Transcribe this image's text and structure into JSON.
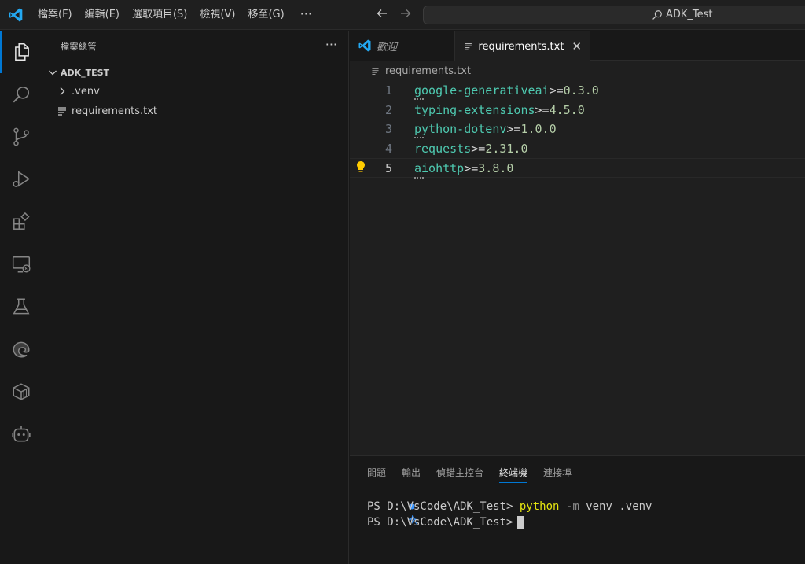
{
  "titlebar": {
    "menu": [
      "檔案(F)",
      "編輯(E)",
      "選取項目(S)",
      "檢視(V)",
      "移至(G)"
    ],
    "more": "···",
    "search_label": "ADK_Test"
  },
  "colors": {
    "accent": "#0078d4",
    "vscode_blue": "#23a9f2",
    "lightbulb": "#ffcc00"
  },
  "activitybar": {
    "items": [
      "explorer-icon",
      "search-icon",
      "source-control-icon",
      "run-debug-icon",
      "extensions-icon",
      "remote-explorer-icon",
      "testing-icon",
      "edge-icon",
      "containers-icon",
      "copilot-icon"
    ]
  },
  "sidebar": {
    "title": "檔案總管",
    "more": "···",
    "folder": "ADK_TEST",
    "items": [
      {
        "label": ".venv",
        "type": "folder"
      },
      {
        "label": "requirements.txt",
        "type": "file"
      }
    ]
  },
  "editor": {
    "tabs": [
      {
        "label": "歡迎",
        "active": false
      },
      {
        "label": "requirements.txt",
        "active": true
      }
    ],
    "close": "✕",
    "breadcrumb": "requirements.txt",
    "lines": [
      {
        "num": "1",
        "pkg": "google-generativeai",
        "op": ">=",
        "ver": "0.3.0"
      },
      {
        "num": "2",
        "pkg": "typing-extensions",
        "op": ">=",
        "ver": "4.5.0"
      },
      {
        "num": "3",
        "pkg": "python-dotenv",
        "op": ">=",
        "ver": "1.0.0"
      },
      {
        "num": "4",
        "pkg": "requests",
        "op": ">=",
        "ver": "2.31.0"
      },
      {
        "num": "5",
        "pkg": "aiohttp",
        "op": ">=",
        "ver": "3.8.0"
      }
    ]
  },
  "panel": {
    "tabs": [
      "問題",
      "輸出",
      "偵錯主控台",
      "終端機",
      "連接埠"
    ],
    "active_tab": "終端機",
    "terminal": [
      {
        "prompt": "PS D:\\VsCode\\ADK_Test>",
        "cmd": "python",
        "flag": "-m",
        "args": "venv .venv"
      },
      {
        "prompt": "PS D:\\VsCode\\ADK_Test>"
      }
    ]
  }
}
